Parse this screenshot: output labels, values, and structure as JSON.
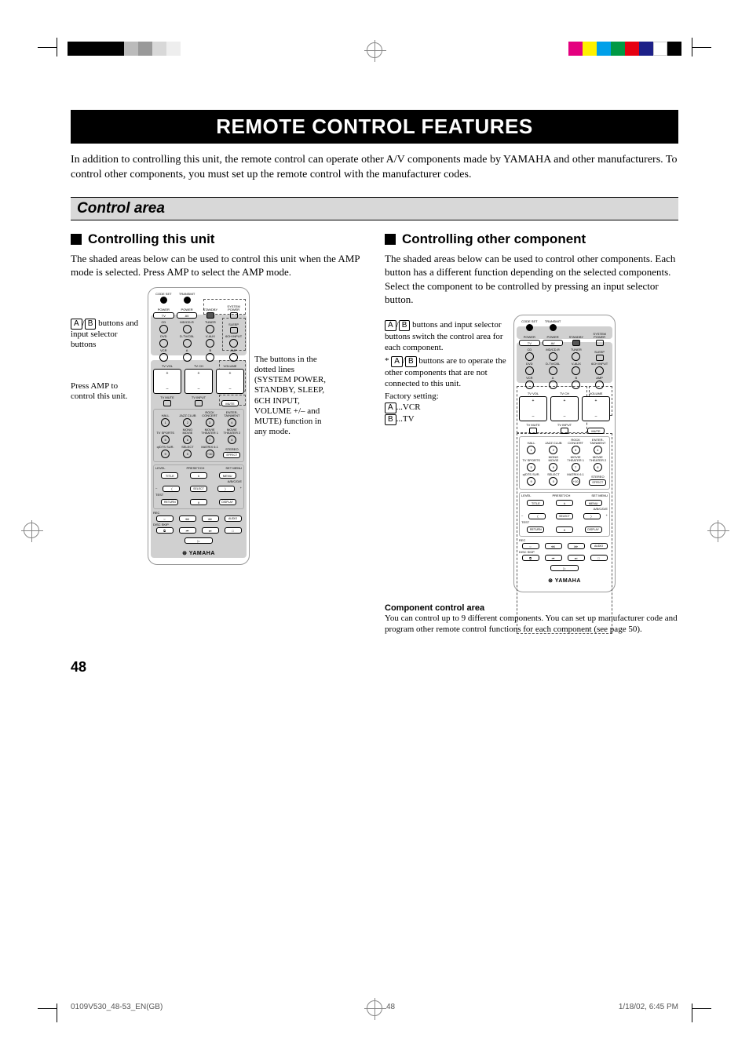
{
  "title": "REMOTE CONTROL FEATURES",
  "intro": "In addition to controlling this unit, the remote control can operate other A/V components made by YAMAHA and other manufacturers. To control other components, you must set up the remote control with the manufacturer codes.",
  "section": "Control area",
  "left": {
    "heading": "Controlling this unit",
    "body": "The shaded areas below can be used to control this unit when the AMP mode is selected. Press AMP to select the AMP mode.",
    "note1_pre": "",
    "note1_post": " buttons and input selector buttons",
    "note2": "Press AMP to control this unit.",
    "right_note": "The buttons in the dotted lines (SYSTEM POWER, STANDBY, SLEEP, 6CH INPUT, VOLUME +/– and MUTE) function in any mode."
  },
  "right": {
    "heading": "Controlling other component",
    "body": "The shaded areas below can be used to control other components. Each button has a different function depending on the selected components. Select the component to be controlled by pressing an input selector button.",
    "note1_post": " buttons and input selector buttons switch the control area for each component.",
    "star_pre": "* ",
    "star_post": " buttons are to operate the other components that are not connected to this unit.",
    "factory": "Factory setting:",
    "setA": "...VCR",
    "setB": "...TV",
    "comp_heading": "Component control area",
    "comp_body": "You can control up to 9 different components. You can set up manufacturer code and program other remote control functions for each component (see page 50)."
  },
  "remote_labels": {
    "r1": [
      "CODE SET",
      "TRANSMIT",
      "",
      ""
    ],
    "r2": [
      "POWER",
      "POWER",
      "STANDBY",
      "SYSTEM POWER"
    ],
    "r3": [
      "TV",
      "AV",
      "",
      ""
    ],
    "r4": [
      "CD",
      "MD/CD-R",
      "TUNER",
      "SLEEP"
    ],
    "r5": [
      "DVD",
      "D-TV/CBL",
      "V-AUX",
      "6CH INPUT"
    ],
    "r6": [
      "VCR",
      "A",
      "B",
      "AMP"
    ],
    "vol": [
      "+",
      "–"
    ],
    "tvvol": "TV VOL",
    "tvch": "TV CH",
    "volume": "VOLUME",
    "tvmute": "TV MUTE",
    "tvinput": "TV INPUT",
    "mute": "MUTE",
    "dsp1": [
      "HALL",
      "JAZZ CLUB",
      "ROCK CONCERT",
      "ENTER-TAINMENT"
    ],
    "dsp2": [
      "TV SPORTS",
      "MONO MOVIE",
      "MOVIE THEATER 1",
      "MOVIE THEATER 2"
    ],
    "dsp3": [
      "q/DTS SUR.",
      "SELECT",
      "MATRIX 6.1",
      "STEREO"
    ],
    "dspn1": [
      "1",
      "2",
      "3",
      "4"
    ],
    "dspn2": [
      "5",
      "6",
      "7",
      "8"
    ],
    "dspn3": [
      "9",
      "0",
      "+10",
      ""
    ],
    "effect": "EFFECT",
    "nav": [
      "LEVEL",
      "PRESET/CH",
      "SET MENU",
      "TITLE",
      "MENU",
      "A/B/C/D/E",
      "SELECT",
      "TEST",
      "RETURN",
      "DISPLAY"
    ],
    "rec": "REC",
    "discskip": "DISC SKIP",
    "audio": "AUDIO",
    "brand": "YAMAHA",
    "plus": "+",
    "minus": "–"
  },
  "keys": {
    "A": "A",
    "B": "B",
    "slash": "/"
  },
  "page_num": "48",
  "footer": {
    "file": "0109V530_48-53_EN(GB)",
    "page": "48",
    "date": "1/18/02, 6:45 PM"
  }
}
